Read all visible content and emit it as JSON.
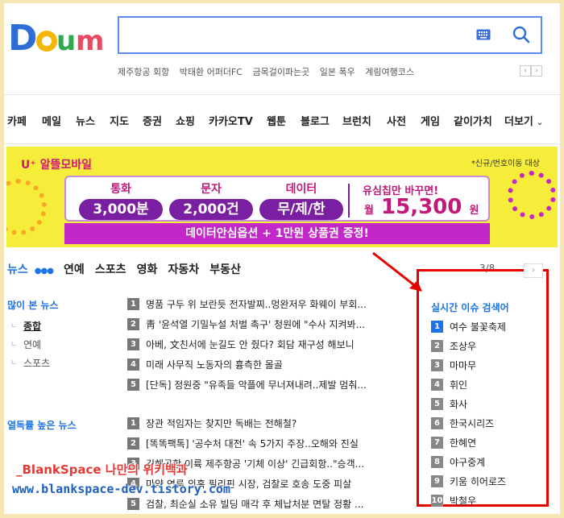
{
  "logo": {
    "text": "Daum"
  },
  "search": {
    "value": "",
    "placeholder": ""
  },
  "issues": [
    "제주항공 회항",
    "박태환 어퍼더FC",
    "금목걸이파는곳",
    "일본 폭우",
    "계림여행코스"
  ],
  "gnb": [
    "카페",
    "메일",
    "뉴스",
    "지도",
    "증권",
    "쇼핑",
    "카카오TV",
    "웹툰",
    "블로그",
    "브런치",
    "사전",
    "게임",
    "같이가치",
    "더보기"
  ],
  "ad": {
    "brand": "U⁺ 알뜰모바일",
    "note": "*신규/번호이동 대상",
    "cols": [
      {
        "label": "통화",
        "value": "3,000분"
      },
      {
        "label": "문자",
        "value": "2,000건"
      },
      {
        "label": "데이터",
        "value": "무/제/한"
      }
    ],
    "right_line1": "유심칩만 바꾸면!",
    "right_prefix": "월",
    "right_price": "15,300",
    "right_unit": "원",
    "bottom": "데이터안심옵션 + 1만원 상품권 증정!"
  },
  "news_tabs": [
    "뉴스",
    "연예",
    "스포츠",
    "영화",
    "자동차",
    "부동산"
  ],
  "pager": "3/8",
  "most_viewed": {
    "title": "많이 본 뉴스",
    "subs": [
      "종합",
      "연예",
      "스포츠"
    ],
    "items": [
      "명품 구두 위 보란듯 전자발찌..멍완저우 화웨이 부회...",
      "靑 '윤석열 기밀누설 처벌 촉구' 청원에 \"수사 지켜봐...",
      "아베, 文친서에 눈길도 안 줬다? 회담 재구성 해보니",
      "미래 사무직 노동자의 흉측한 몰골",
      "[단독] 정원중 \"유족들 악플에 무너져내려..제발 멈춰..."
    ]
  },
  "hot_comments": {
    "title": "열독률 높은 뉴스",
    "items": [
      "장관 적임자는 찾지만 독배는 전해철?",
      "[똑똑팩톡] '공수처 대전' 속 5가지 주장..오해와 진실",
      "김해공항 이륙 제주항공 '기체 이상' 긴급회항..\"승객...",
      "마약 연루 의혹 필리핀 시장, 검찰로 호송 도중 피살",
      "검찰, 최순실 소유 빌딩 매각 후 체납처분 면탈 정황 ..."
    ]
  },
  "realtime": {
    "title": "실시간 이슈 검색어",
    "items": [
      "여수 불꽃축제",
      "조상우",
      "마마무",
      "휘인",
      "화사",
      "한국시리즈",
      "한혜연",
      "야구중계",
      "키움 히어로즈",
      "박철우"
    ]
  },
  "watermark": {
    "line1": "_BlankSpace 나만의 위키백과",
    "line2": "www.blankspace-dev.tistory.com"
  }
}
